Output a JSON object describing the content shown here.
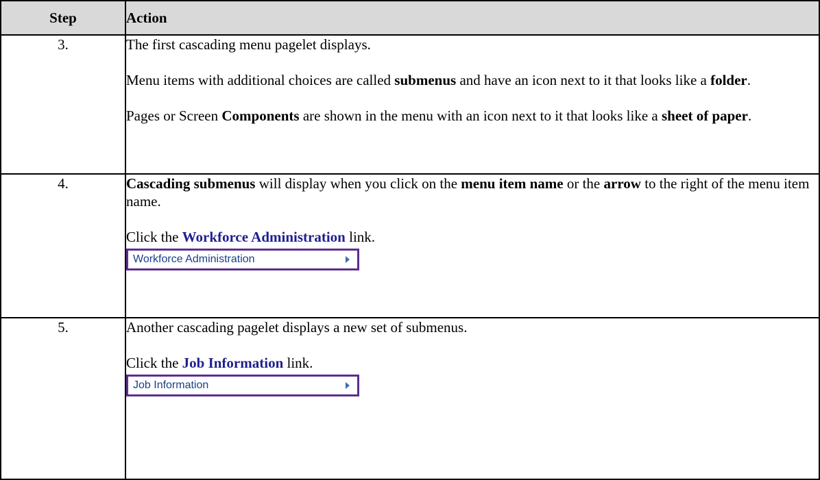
{
  "header": {
    "step": "Step",
    "action": "Action"
  },
  "rows": [
    {
      "step": "3.",
      "p1": "The first cascading menu pagelet displays.",
      "p2": {
        "a": "Menu items with additional choices are called ",
        "b": "submenus",
        "c": " and have an icon next to it that looks like a ",
        "d": "folder",
        "e": "."
      },
      "p3": {
        "a": "Pages or Screen ",
        "b": "Components",
        "c": " are shown in the menu with an icon next to it that looks like a ",
        "d": "sheet of paper",
        "e": "."
      }
    },
    {
      "step": "4.",
      "p1": {
        "a": "Cascading submenus",
        "b": " will display when you click on the ",
        "c": "menu item name",
        "d": " or the ",
        "e": "arrow",
        "f": " to the right of the menu item name."
      },
      "p2": {
        "a": "Click the ",
        "b": "Workforce Administration",
        "c": " link."
      },
      "button": "Workforce Administration"
    },
    {
      "step": "5.",
      "p1": "Another cascading pagelet displays a new set of submenus.",
      "p2": {
        "a": "Click the ",
        "b": "Job Information",
        "c": " link."
      },
      "button": "Job Information"
    }
  ],
  "colors": {
    "header_bg": "#d9d9d9",
    "button_border": "#5c2d91",
    "link_text": "#1f1f8f"
  },
  "icons": {
    "menu_arrow": "right-arrow-icon"
  }
}
